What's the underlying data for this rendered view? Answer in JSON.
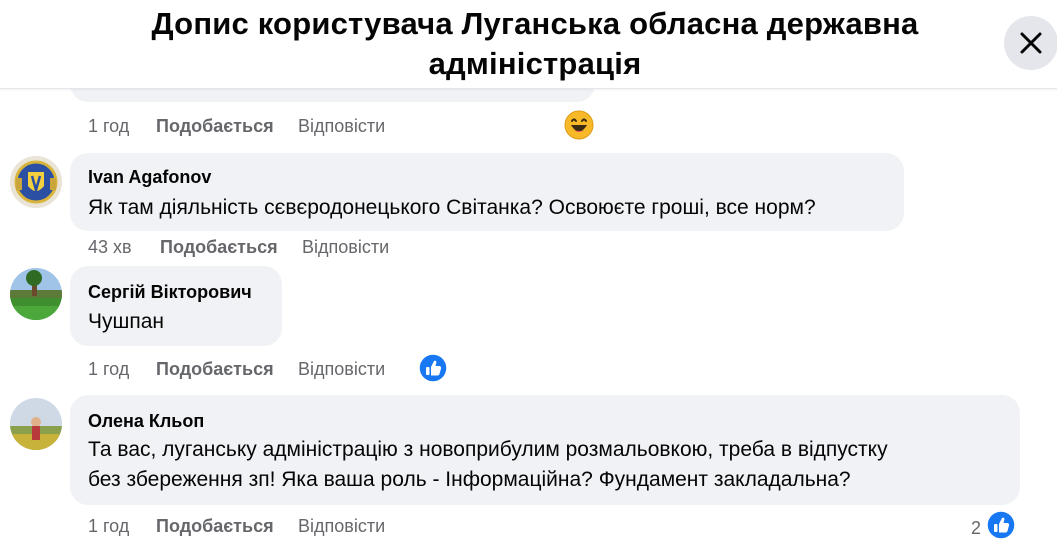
{
  "header": {
    "title": "Допис користувача Луганська обласна державна адміністрація",
    "close_icon": "close-icon"
  },
  "colors": {
    "bubble_bg": "#f0f2f5",
    "muted_text": "#65676b",
    "like_blue": "#1877f2",
    "close_bg": "#e4e6eb"
  },
  "prev_comment": {
    "time": "1 год",
    "like_label": "Подобається",
    "reply_label": "Відповісти",
    "reaction_icon": "haha-emoji-icon"
  },
  "comments": [
    {
      "author": "Ivan Agafonov",
      "text_lines": [
        "Як там діяльність сєвєродонецького Світанка? Освоюєте гроші, все норм?"
      ],
      "time": "43 хв",
      "like_label": "Подобається",
      "reply_label": "Відповісти"
    },
    {
      "author": "Сергій Вікторович",
      "text_lines": [
        "Чушпан"
      ],
      "time": "1 год",
      "like_label": "Подобається",
      "reply_label": "Відповісти",
      "reaction_icon": "like-thumb-icon"
    },
    {
      "author": "Олена Кльоп",
      "text_lines": [
        "Та вас, луганську адміністрацію з новоприбулим розмальовкою, треба в відпустку",
        "без збереження зп! Яка ваша роль - Інформаційна? Фундамент закладальна?"
      ],
      "time": "1 год",
      "like_label": "Подобається",
      "reply_label": "Відповісти",
      "reaction_icon": "like-thumb-icon",
      "reaction_count": "2"
    }
  ]
}
